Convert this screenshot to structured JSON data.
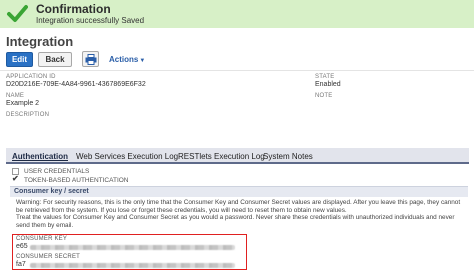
{
  "banner": {
    "title": "Confirmation",
    "message": "Integration successfully Saved"
  },
  "page": {
    "title": "Integration"
  },
  "toolbar": {
    "edit_label": "Edit",
    "back_label": "Back",
    "actions_label": "Actions",
    "actions_caret": "▼"
  },
  "fields": {
    "application_id_label": "APPLICATION ID",
    "application_id": "D20D216E-709E-4A84-9961-4367869E6F32",
    "name_label": "NAME",
    "name": "Example 2",
    "description_label": "DESCRIPTION",
    "state_label": "STATE",
    "state": "Enabled",
    "note_label": "NOTE"
  },
  "tabs": [
    "Authentication",
    "Web Services Execution Log",
    "RESTlets Execution Log",
    "System Notes"
  ],
  "auth": {
    "user_credentials": "USER CREDENTIALS",
    "token_based": "TOKEN-BASED AUTHENTICATION",
    "token_based_checked": true
  },
  "consumer_section": {
    "title": "Consumer key / secret",
    "warning_lines": [
      "Warning: For security reasons, this is the only time that the Consumer Key and Consumer Secret values are displayed. After you leave this page, they cannot",
      "be retrieved from the system. If you lose or forget these credentials, you will need to reset them to obtain new values.",
      "Treat the values for Consumer Key and Consumer Secret as you would a password. Never share these credentials with unauthorized individuals and never",
      "send them by email."
    ],
    "consumer_key_label": "CONSUMER KEY",
    "consumer_key_prefix": "e65",
    "consumer_secret_label": "CONSUMER SECRET",
    "consumer_secret_prefix": "fa7"
  },
  "colors": {
    "banner_bg": "#d7f0c7",
    "check_green": "#3aa534",
    "primary_button": "#2a71c4",
    "highlight_red": "#e02020",
    "tab_bar": "#e2e4ec"
  },
  "icons": {
    "banner": "checkmark-icon",
    "print": "printer-icon"
  }
}
